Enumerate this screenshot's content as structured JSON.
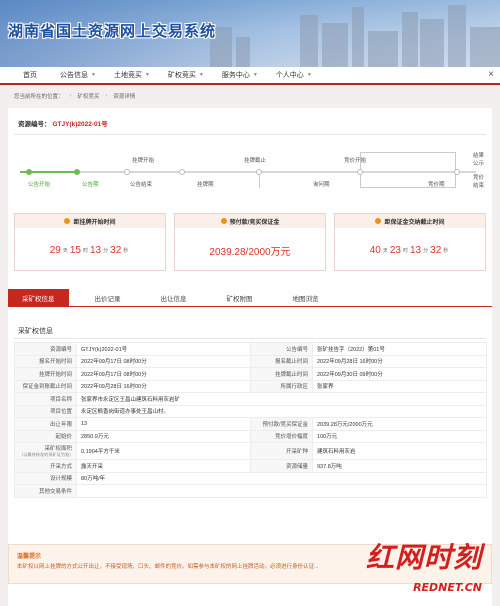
{
  "header": {
    "title": "湖南省国土资源网上交易系统"
  },
  "nav": {
    "items": [
      {
        "label": "首页"
      },
      {
        "label": "公告信息"
      },
      {
        "label": "土地竞买"
      },
      {
        "label": "矿权竞买"
      },
      {
        "label": "服务中心"
      },
      {
        "label": "个人中心"
      }
    ],
    "close": "×"
  },
  "breadcrumb": {
    "prefix": "您当前所在的位置：",
    "level1": "矿权竞买",
    "level2": "资源详情"
  },
  "resource": {
    "code_label": "资源编号：",
    "code_value": "GTJY(k)2022-01号"
  },
  "timeline": {
    "top": [
      "挂牌开始",
      "挂牌截止",
      "竞价开始",
      "结果公示"
    ],
    "bottom": [
      "公告开始",
      "公告期",
      "公告结束",
      "挂牌期",
      "询问期",
      "竞价期",
      "竞价结束"
    ],
    "progress_percent": 13
  },
  "countdowns": [
    {
      "title": "距挂牌开始时间",
      "d": "29",
      "h": "15",
      "m": "13",
      "s": "32"
    },
    {
      "title": "预付款/竞买保证金",
      "value": "2039.28/2000万元"
    },
    {
      "title": "距保证金交纳截止时间",
      "d": "40",
      "h": "23",
      "m": "13",
      "s": "32"
    }
  ],
  "units": {
    "day": "天",
    "hour": "时",
    "min": "分",
    "sec": "秒"
  },
  "tabs": [
    "采矿权信息",
    "出价记录",
    "出让信息",
    "矿权附图",
    "地图浏览"
  ],
  "section_title": "采矿权信息",
  "table": {
    "rows": [
      [
        "资源编号",
        "GTJY(k)2022-01号",
        "公告编号",
        "张矿挂告字（2022）第01号"
      ],
      [
        "报名开始时间",
        "2022年09月17日 08时00分",
        "报名截止时间",
        "2022年09月28日 16时00分"
      ],
      [
        "挂牌开始时间",
        "2022年09月17日 08时00分",
        "挂牌截止时间",
        "2022年09月30日 09时00分"
      ],
      [
        "保证金到账截止时间",
        "2022年09月28日 16时00分",
        "所属行政区",
        "张家界"
      ],
      [
        "项目名称",
        "张家界市永定区王昌山建筑石料用灰岩矿",
        "",
        ""
      ],
      [
        "项目位置",
        "永定区枫香岗街道办事处王昌山村。",
        "",
        ""
      ],
      [
        "出让年限",
        "13",
        "预付款/竞买保证金",
        "2039.28万元/2000万元"
      ],
      [
        "起始价",
        "2850.9万元",
        "竞价增价幅度",
        "100万元"
      ],
      [
        "采矿权面积",
        "0.1904平方千米",
        "开采矿种",
        "建筑石料用灰岩"
      ],
      [
        "开采方式",
        "露天开采",
        "资源储量",
        "937.8万吨"
      ],
      [
        "设计规模",
        "80万吨/年",
        "",
        ""
      ],
      [
        "其他交易条件",
        "",
        "",
        ""
      ]
    ],
    "area_note": "（以最终核发的采矿证为准）"
  },
  "tip": {
    "title": "温馨提示",
    "text": "本矿权以网上挂牌的方式公开出让，不接受现场、口头、邮件的竞价。如需参与本矿权的网上挂牌活动，必须进行身份认证..."
  },
  "watermark": {
    "big": "红网时刻",
    "small": "REDNET.CN"
  }
}
